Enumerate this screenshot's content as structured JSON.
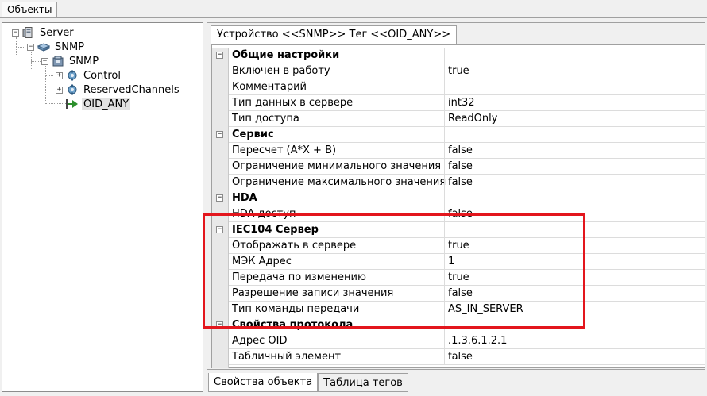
{
  "top_tab": "Объекты",
  "tree": {
    "server": "Server",
    "snmp1": "SNMP",
    "snmp2": "SNMP",
    "control": "Control",
    "reserved": "ReservedChannels",
    "oid": "OID_ANY"
  },
  "device_tab": "Устройство <<SNMP>> Тег  <<OID_ANY>>",
  "rows": [
    {
      "name": "Общие настройки",
      "value": "",
      "category": true
    },
    {
      "name": "Включен в работу",
      "value": "true"
    },
    {
      "name": "Комментарий",
      "value": ""
    },
    {
      "name": "Тип данных в сервере",
      "value": "int32"
    },
    {
      "name": "Тип доступа",
      "value": "ReadOnly"
    },
    {
      "name": "Сервис",
      "value": "",
      "category": true
    },
    {
      "name": "Пересчет (A*X + B)",
      "value": "false"
    },
    {
      "name": "Ограничение минимального значения",
      "value": "false"
    },
    {
      "name": "Ограничение максимального значения",
      "value": "false"
    },
    {
      "name": "HDA",
      "value": "",
      "category": true
    },
    {
      "name": "HDA доступ",
      "value": "false"
    },
    {
      "name": "IEC104 Сервер",
      "value": "",
      "category": true
    },
    {
      "name": "Отображать в сервере",
      "value": "true"
    },
    {
      "name": "МЭК Адрес",
      "value": "1"
    },
    {
      "name": "Передача по изменению",
      "value": "true"
    },
    {
      "name": "Разрешение записи значения",
      "value": "false"
    },
    {
      "name": "Тип команды передачи",
      "value": "AS_IN_SERVER"
    },
    {
      "name": "Свойства протокола",
      "value": "",
      "category": true
    },
    {
      "name": "Адрес OID",
      "value": ".1.3.6.1.2.1"
    },
    {
      "name": "Табличный элемент",
      "value": "false"
    }
  ],
  "bottom_tabs": [
    "Свойства объекта",
    "Таблица тегов"
  ],
  "colors": {
    "highlight": "#e3161d",
    "selection": "#e2e2e2"
  }
}
